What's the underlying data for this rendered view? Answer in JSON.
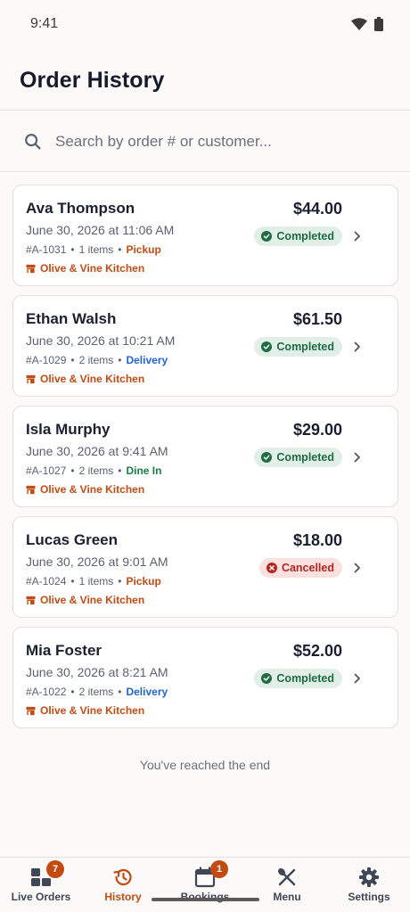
{
  "status_bar": {
    "time": "9:41"
  },
  "header": {
    "title": "Order History"
  },
  "search": {
    "placeholder": "Search by order # or customer..."
  },
  "orders": [
    {
      "customer": "Ava Thompson",
      "datetime": "June 30, 2026 at 11:06 AM",
      "order_id": "#A-1031",
      "items": "1 items",
      "type": "Pickup",
      "kitchen": "Olive & Vine Kitchen",
      "amount": "$44.00",
      "status": "Completed"
    },
    {
      "customer": "Ethan Walsh",
      "datetime": "June 30, 2026 at 10:21 AM",
      "order_id": "#A-1029",
      "items": "2 items",
      "type": "Delivery",
      "kitchen": "Olive & Vine Kitchen",
      "amount": "$61.50",
      "status": "Completed"
    },
    {
      "customer": "Isla Murphy",
      "datetime": "June 30, 2026 at 9:41 AM",
      "order_id": "#A-1027",
      "items": "2 items",
      "type": "Dine In",
      "kitchen": "Olive & Vine Kitchen",
      "amount": "$29.00",
      "status": "Completed"
    },
    {
      "customer": "Lucas Green",
      "datetime": "June 30, 2026 at 9:01 AM",
      "order_id": "#A-1024",
      "items": "1 items",
      "type": "Pickup",
      "kitchen": "Olive & Vine Kitchen",
      "amount": "$18.00",
      "status": "Cancelled"
    },
    {
      "customer": "Mia Foster",
      "datetime": "June 30, 2026 at 8:21 AM",
      "order_id": "#A-1022",
      "items": "2 items",
      "type": "Delivery",
      "kitchen": "Olive & Vine Kitchen",
      "amount": "$52.00",
      "status": "Completed"
    }
  ],
  "meta_separator": "•",
  "end_message": "You've reached the end",
  "nav": {
    "items": [
      {
        "label": "Live Orders",
        "icon": "grid-icon",
        "badge": "7"
      },
      {
        "label": "History",
        "icon": "history-icon"
      },
      {
        "label": "Bookings",
        "icon": "calendar-icon",
        "badge": "1"
      },
      {
        "label": "Menu",
        "icon": "utensils-icon"
      },
      {
        "label": "Settings",
        "icon": "gear-icon"
      }
    ],
    "active": "History"
  },
  "colors": {
    "accent": "#c24b13",
    "completed_bg": "#e1efe6",
    "completed_text": "#1e6b44",
    "cancelled_bg": "#fae1df",
    "cancelled_text": "#b3261e",
    "delivery": "#2263d6",
    "dine_in": "#197d4c"
  }
}
